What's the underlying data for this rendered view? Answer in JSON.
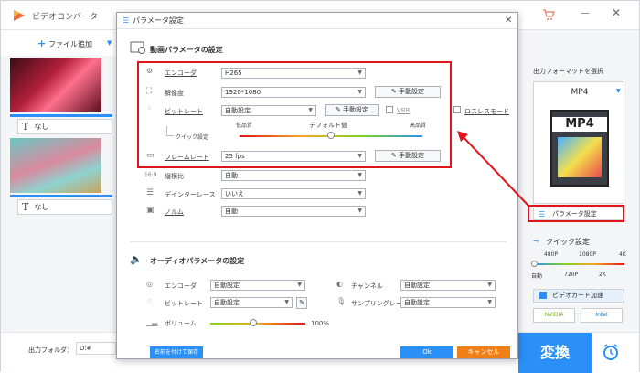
{
  "app": {
    "title": "ビデオコンバータ",
    "add_file_label": "ファイル追加",
    "subtitle_none_1": "なし",
    "subtitle_none_2": "なし",
    "output_folder_label": "出力フォルダ：",
    "output_folder_value": "D:¥",
    "convert_label": "変換"
  },
  "right_panel": {
    "select_format_label": "出力フォーマットを選択",
    "format_value": "MP4",
    "format_badge": "MP4",
    "param_settings_label": "パラメータ設定",
    "quick_settings_label": "クイック設定",
    "quality_top": [
      "480P",
      "1080P",
      "4K"
    ],
    "quality_bottom": [
      "自動",
      "720P",
      "2K"
    ],
    "gpu_label": "ビデオカード加速",
    "gpu_vendors": [
      "NVIDIA",
      "Intel"
    ]
  },
  "dialog": {
    "title": "パラメータ設定",
    "video_section_title": "動画パラメータの設定",
    "audio_section_title": "オーディオパラメータの設定",
    "video": {
      "encoder_label": "エンコーダ",
      "encoder_value": "H265",
      "resolution_label": "解像度",
      "resolution_value": "1920*1080",
      "manual_label_1": "手動設定",
      "bitrate_label": "ビットレート",
      "bitrate_value": "自動設定",
      "manual_label_2": "手動設定",
      "vbr_label": "VBR",
      "lossless_label": "ロスレスモード",
      "quick_label": "クイック設定",
      "quality_low": "低品質",
      "quality_default": "デフォルト値",
      "quality_high": "高品質",
      "framerate_label": "フレームレート",
      "framerate_value": "25 fps",
      "manual_label_3": "手動設定",
      "aspect_label": "縦横比",
      "aspect_value": "自動",
      "deinterlace_label": "デインターレース",
      "deinterlace_value": "いいえ",
      "norm_label": "ノルム",
      "norm_value": "自動"
    },
    "audio": {
      "encoder_label": "エンコーダ",
      "encoder_value": "自動設定",
      "channel_label": "チャンネル",
      "channel_value": "自動設定",
      "bitrate_label": "ビットレート",
      "bitrate_value": "自動設定",
      "samplerate_label": "サンプリングレート",
      "samplerate_value": "自動設定",
      "volume_label": "ボリューム",
      "volume_value": "100%",
      "volume_level": 0.45
    },
    "save_as_label": "名前を付けて保存",
    "ok_label": "Ok",
    "cancel_label": "キャンセル"
  },
  "colors": {
    "accent": "#2a8ff7",
    "highlight": "#e0151b",
    "orange": "#f07f16"
  }
}
